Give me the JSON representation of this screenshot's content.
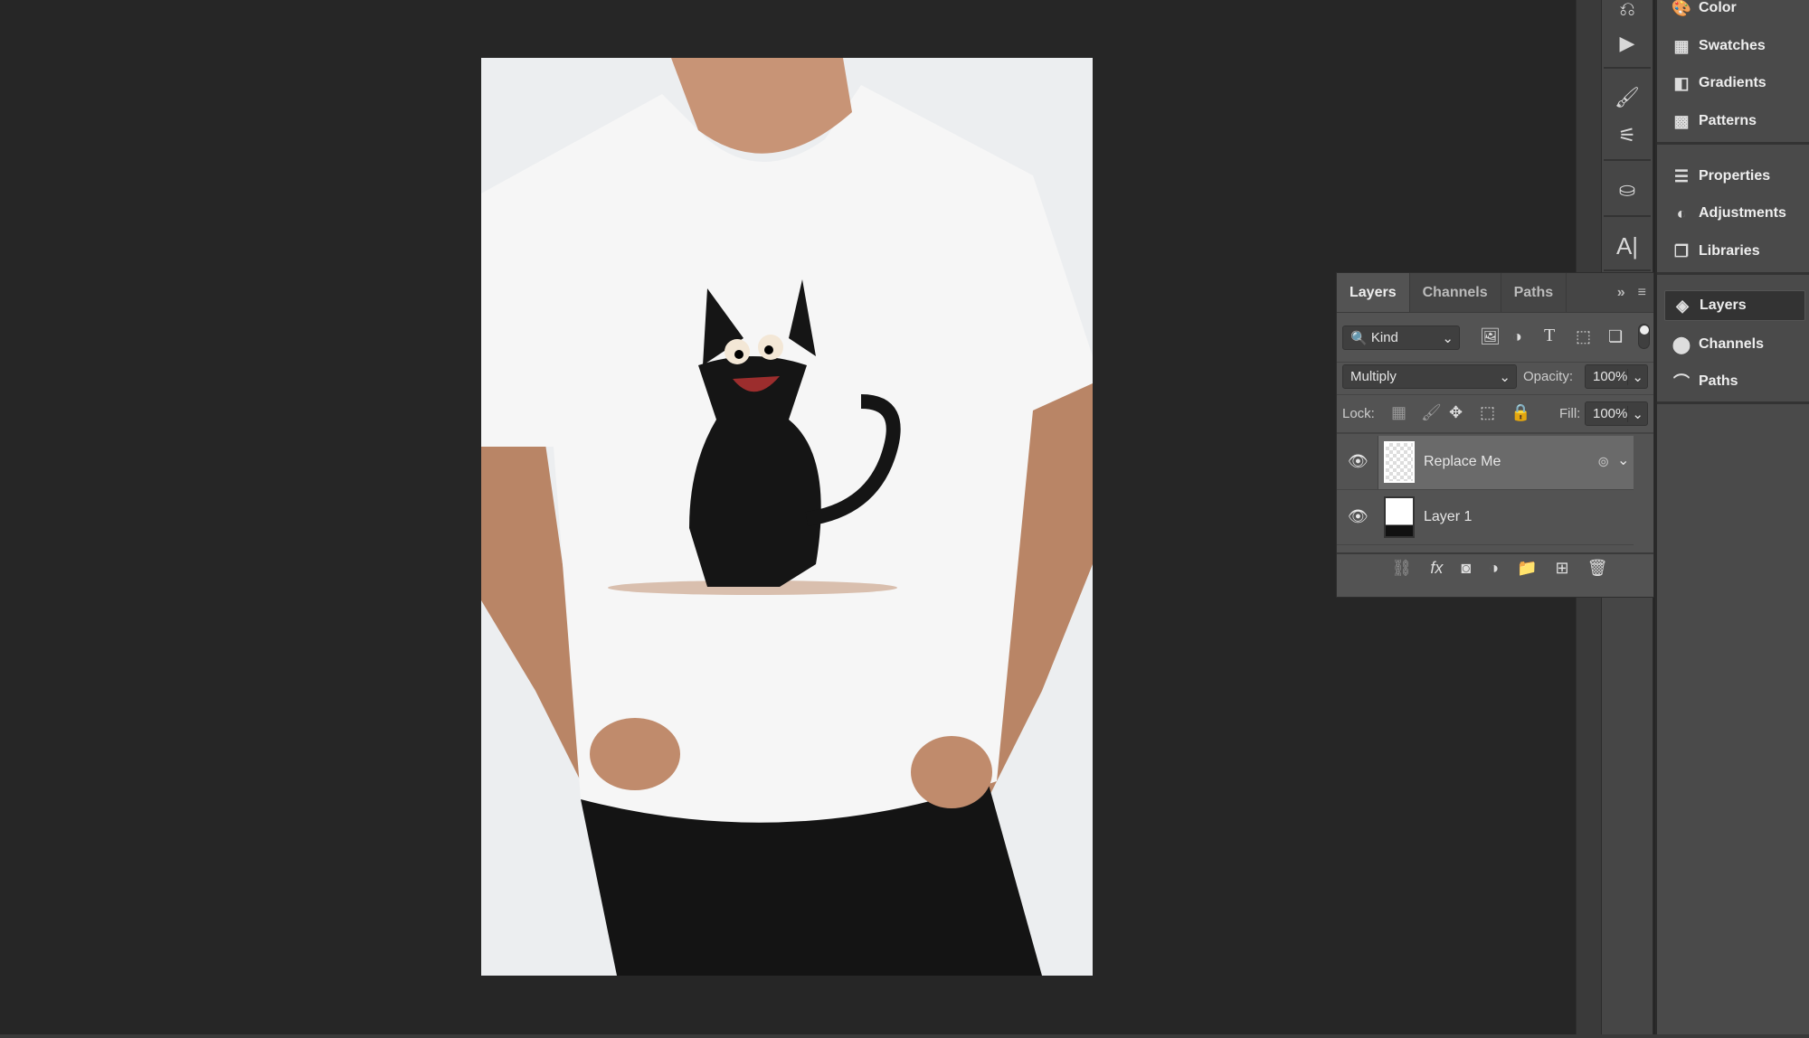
{
  "canvas": {
    "image": "man in white t-shirt with black cartoon cat print"
  },
  "tool_strip": {
    "icons": [
      "history-icon",
      "play-action-icon",
      "brush-presets-icon",
      "brush-settings-icon",
      "clone-source-icon",
      "character-icon"
    ]
  },
  "dock": {
    "items": [
      {
        "label": "Color",
        "icon": "palette-icon"
      },
      {
        "label": "Swatches",
        "icon": "swatches-icon"
      },
      {
        "label": "Gradients",
        "icon": "gradients-icon"
      },
      {
        "label": "Patterns",
        "icon": "patterns-icon"
      },
      {
        "label": "Properties",
        "icon": "sliders-icon"
      },
      {
        "label": "Adjustments",
        "icon": "adjustments-icon"
      },
      {
        "label": "Libraries",
        "icon": "libraries-icon"
      },
      {
        "label": "Layers",
        "icon": "layers-icon"
      },
      {
        "label": "Channels",
        "icon": "channels-icon"
      },
      {
        "label": "Paths",
        "icon": "paths-icon"
      }
    ],
    "active": "Layers"
  },
  "layers_panel": {
    "tabs": [
      "Layers",
      "Channels",
      "Paths"
    ],
    "filter": "Kind",
    "blend_mode": "Multiply",
    "opacity_label": "Opacity:",
    "opacity": "100%",
    "lock_label": "Lock:",
    "fill_label": "Fill:",
    "fill": "100%",
    "layers": [
      {
        "name": "Replace Me",
        "visible": true,
        "selected": true,
        "smart_object": true
      },
      {
        "name": "Layer 1",
        "visible": true,
        "selected": false
      }
    ]
  }
}
